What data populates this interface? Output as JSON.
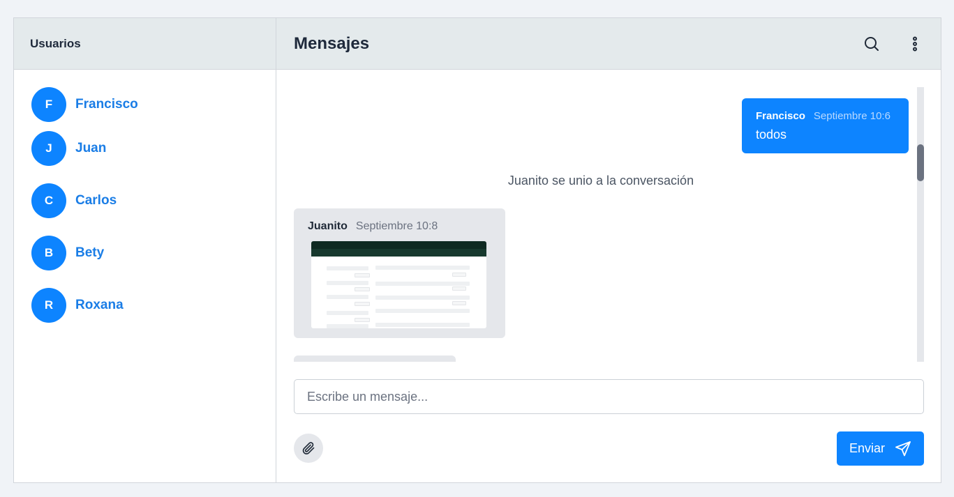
{
  "sidebar": {
    "title": "Usuarios",
    "users": [
      {
        "initial": "F",
        "name": "Francisco"
      },
      {
        "initial": "J",
        "name": "Juan"
      },
      {
        "initial": "C",
        "name": "Carlos"
      },
      {
        "initial": "B",
        "name": "Bety"
      },
      {
        "initial": "R",
        "name": "Roxana"
      }
    ]
  },
  "header": {
    "title": "Mensajes",
    "search_icon": "search-icon",
    "menu_icon": "more-vertical-icon"
  },
  "messages": {
    "outgoing": {
      "sender": "Francisco",
      "time": "Septiembre 10:6",
      "text": "todos"
    },
    "system": "Juanito se unio a la conversación",
    "incoming": {
      "sender": "Juanito",
      "time": "Septiembre 10:8",
      "attachment_icon": "image-thumbnail"
    }
  },
  "composer": {
    "placeholder": "Escribe un mensaje...",
    "value": "",
    "attach_icon": "paperclip-icon",
    "send_label": "Enviar",
    "send_icon": "send-icon"
  },
  "colors": {
    "accent": "#0d84ff",
    "header_bg": "#e4eaec",
    "bubble_in_bg": "#e5e7eb",
    "page_bg": "#f0f3f7"
  }
}
